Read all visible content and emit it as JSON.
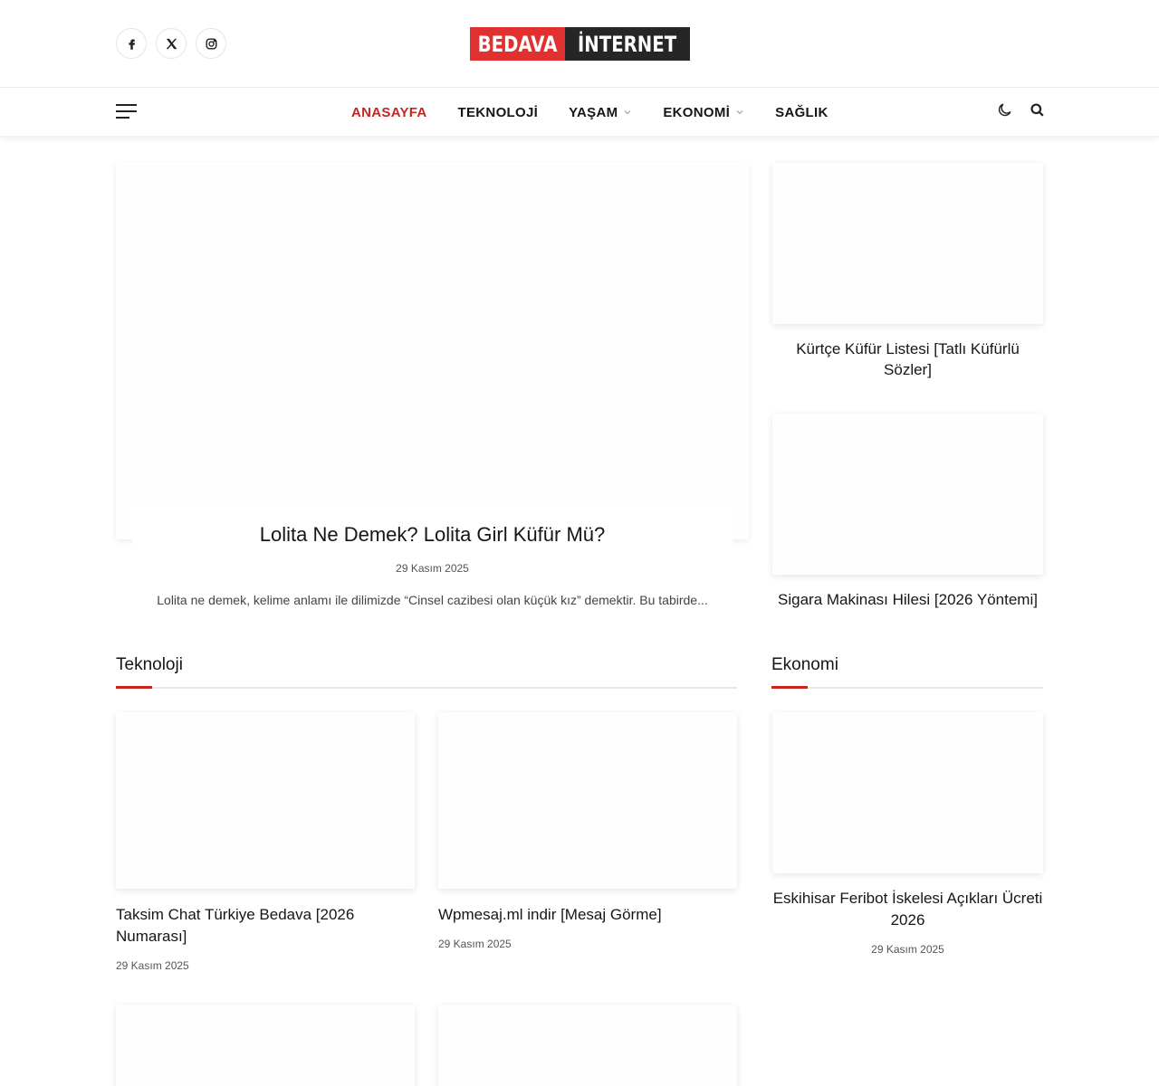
{
  "header": {
    "logo": {
      "part1": "BEDAVA",
      "part2": "İNTERNET",
      "color1": "#e0302f",
      "color2": "#262626"
    },
    "socials": [
      "facebook-icon",
      "x-icon",
      "instagram-icon"
    ]
  },
  "nav": {
    "items": [
      {
        "label": "ANASAYFA",
        "active": true,
        "dropdown": false
      },
      {
        "label": "TEKNOLOJİ",
        "active": false,
        "dropdown": false
      },
      {
        "label": "YAŞAM",
        "active": false,
        "dropdown": true
      },
      {
        "label": "EKONOMİ",
        "active": false,
        "dropdown": true
      },
      {
        "label": "SAĞLIK",
        "active": false,
        "dropdown": false
      }
    ],
    "accent_color": "#c9241f",
    "icons": [
      "menu-icon",
      "moon-icon",
      "search-icon"
    ]
  },
  "featured": {
    "title": "Lolita Ne Demek? Lolita Girl Küfür Mü?",
    "date": "29 Kasım 2025",
    "excerpt": "Lolita ne demek, kelime anlamı ile dilimizde “Cinsel cazibesi olan küçük kız” demektir. Bu tabirde..."
  },
  "side_posts": [
    {
      "title": "Kürtçe Küfür Listesi [Tatlı Küfürlü Sözler]"
    },
    {
      "title": "Sigara Makinası Hilesi [2026 Yöntemi]"
    }
  ],
  "sections": {
    "teknoloji": {
      "heading": "Teknoloji",
      "posts": [
        {
          "title": "Taksim Chat Türkiye Bedava [2026 Numarası]",
          "date": "29 Kasım 2025"
        },
        {
          "title": "Wpmesaj.ml indir [Mesaj Görme]",
          "date": "29 Kasım 2025"
        }
      ]
    },
    "ekonomi": {
      "heading": "Ekonomi",
      "posts": [
        {
          "title": "Eskihisar Feribot İskelesi Açıkları Ücreti 2026",
          "date": "29 Kasım 2025"
        }
      ]
    }
  }
}
